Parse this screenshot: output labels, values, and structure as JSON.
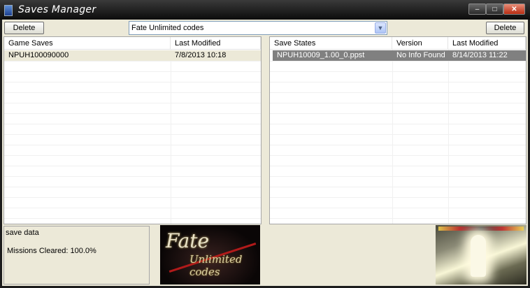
{
  "window": {
    "title": "Saves Manager",
    "controls": {
      "minimize": "–",
      "maximize": "□",
      "close": "✕"
    }
  },
  "toolbar": {
    "delete_left": "Delete",
    "delete_right": "Delete",
    "game_selector": {
      "selected": "Fate Unlimited codes",
      "arrow": "▼"
    }
  },
  "game_saves": {
    "columns": [
      "Game Saves",
      "Last Modified"
    ],
    "rows": [
      {
        "name": "NPUH100090000",
        "modified": "7/8/2013 10:18"
      }
    ]
  },
  "save_states": {
    "columns": [
      "Save States",
      "Version",
      "Last Modified"
    ],
    "rows": [
      {
        "name": "NPUH10009_1.00_0.ppst",
        "version": "No Info Found",
        "modified": "8/14/2013 11:22"
      }
    ]
  },
  "save_info": {
    "title": "save data",
    "missions": "Missions Cleared: 100.0%"
  },
  "banner": {
    "line1": "Fate",
    "line2": "Unlimited codes"
  },
  "colors": {
    "selected_row_gs": "#ece9d8",
    "selected_row_ss": "#808080",
    "title_bar": "#1a1a1a"
  }
}
